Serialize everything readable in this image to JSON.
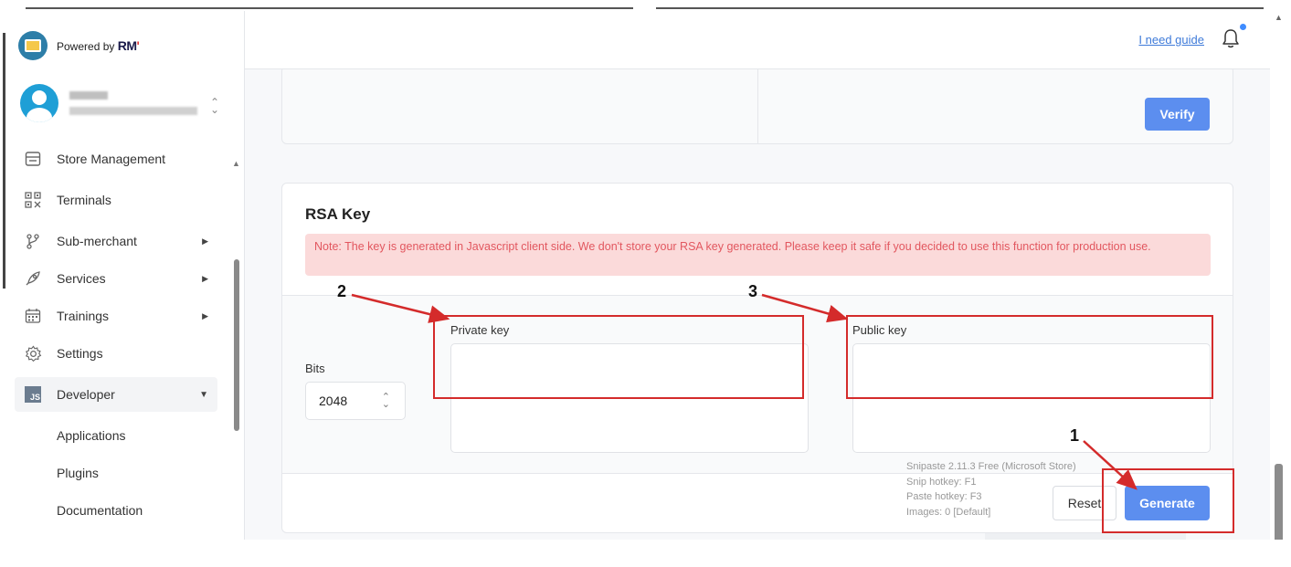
{
  "brand": {
    "powered_by": "Powered by",
    "logo_text": "RM"
  },
  "header": {
    "guide_link": "I need guide"
  },
  "sidebar": {
    "items": [
      {
        "label": "Store Management",
        "icon": "store-icon"
      },
      {
        "label": "Terminals",
        "icon": "qr-code-icon"
      },
      {
        "label": "Sub-merchant",
        "icon": "branch-icon",
        "has_arrow": true
      },
      {
        "label": "Services",
        "icon": "rocket-icon",
        "has_arrow": true
      },
      {
        "label": "Trainings",
        "icon": "calendar-icon",
        "has_arrow": true
      },
      {
        "label": "Settings",
        "icon": "gear-icon"
      },
      {
        "label": "Developer",
        "icon": "js-icon",
        "expanded": true
      }
    ],
    "developer_icon_text": "JS",
    "sub_items": [
      "Applications",
      "Plugins",
      "Documentation"
    ]
  },
  "verify": {
    "button_label": "Verify"
  },
  "rsa": {
    "title": "RSA Key",
    "note": "Note: The key is generated in Javascript client side. We don't store your RSA key generated. Please keep it safe if you decided to use this function for production use.",
    "bits_label": "Bits",
    "bits_value": "2048",
    "private_key_label": "Private key",
    "public_key_label": "Public key",
    "reset_label": "Reset",
    "generate_label": "Generate"
  },
  "snipaste": {
    "line1": "Snipaste 2.11.3 Free (Microsoft Store)",
    "line2": "Snip hotkey: F1",
    "line3": "Paste hotkey: F3",
    "line4": "Images: 0 [Default]"
  },
  "annotations": {
    "step1": "1",
    "step2": "2",
    "step3": "3"
  },
  "colors": {
    "primary": "#5c8eef",
    "note_bg": "#fbdada",
    "note_text": "#e2575f",
    "annotation_red": "#d42b2b",
    "link": "#3f7bd9"
  }
}
